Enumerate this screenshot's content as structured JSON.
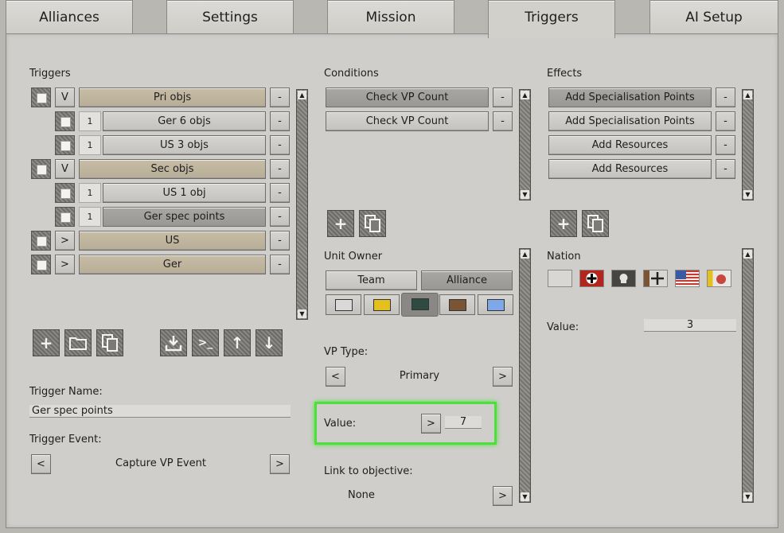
{
  "tabs": [
    "Alliances",
    "Settings",
    "Mission",
    "Triggers",
    "AI Setup"
  ],
  "active_tab": "Triggers",
  "triggers": {
    "title": "Triggers",
    "rows": [
      {
        "toggle": "V",
        "label": "Pri objs",
        "indent": false,
        "tan": true
      },
      {
        "num": "1",
        "label": "Ger 6 objs",
        "indent": true
      },
      {
        "num": "1",
        "label": "US 3 objs",
        "indent": true
      },
      {
        "toggle": "V",
        "label": "Sec objs",
        "indent": false,
        "tan": true
      },
      {
        "num": "1",
        "label": "US 1 obj",
        "indent": true
      },
      {
        "num": "1",
        "label": "Ger spec points",
        "indent": true,
        "selected": true
      },
      {
        "toggle": ">",
        "label": "US",
        "indent": false,
        "tan": true
      },
      {
        "toggle": ">",
        "label": "Ger",
        "indent": false,
        "tan": true
      }
    ],
    "remove_label": "-",
    "name_label": "Trigger Name:",
    "name_value": "Ger spec points",
    "event_label": "Trigger Event:",
    "event_value": "Capture VP Event",
    "prev": "<",
    "next": ">"
  },
  "conditions": {
    "title": "Conditions",
    "items": [
      "Check VP Count",
      "Check VP Count"
    ],
    "remove_label": "-",
    "unit_owner_label": "Unit Owner",
    "team_label": "Team",
    "alliance_label": "Alliance",
    "colors": [
      "#d9d9d9",
      "#e3c01d",
      "#2f4a40",
      "#7a5535",
      "#7fa8e8"
    ],
    "vp_type_label": "VP Type:",
    "vp_type_value": "Primary",
    "value_label": "Value:",
    "value_btn": ">",
    "value": "7",
    "link_label": "Link to objective:",
    "link_value": "None",
    "prev": "<",
    "next": ">"
  },
  "effects": {
    "title": "Effects",
    "items": [
      "Add Specialisation Points",
      "Add Specialisation Points",
      "Add Resources",
      "Add Resources"
    ],
    "remove_label": "-",
    "nation_label": "Nation",
    "value_label": "Value:",
    "value": "3"
  },
  "icons": {
    "add": "+",
    "up": "↑",
    "down": "↓",
    "console": ">_"
  },
  "colors": {
    "highlight": "#4ce03a",
    "tan": "#bfb49e"
  }
}
